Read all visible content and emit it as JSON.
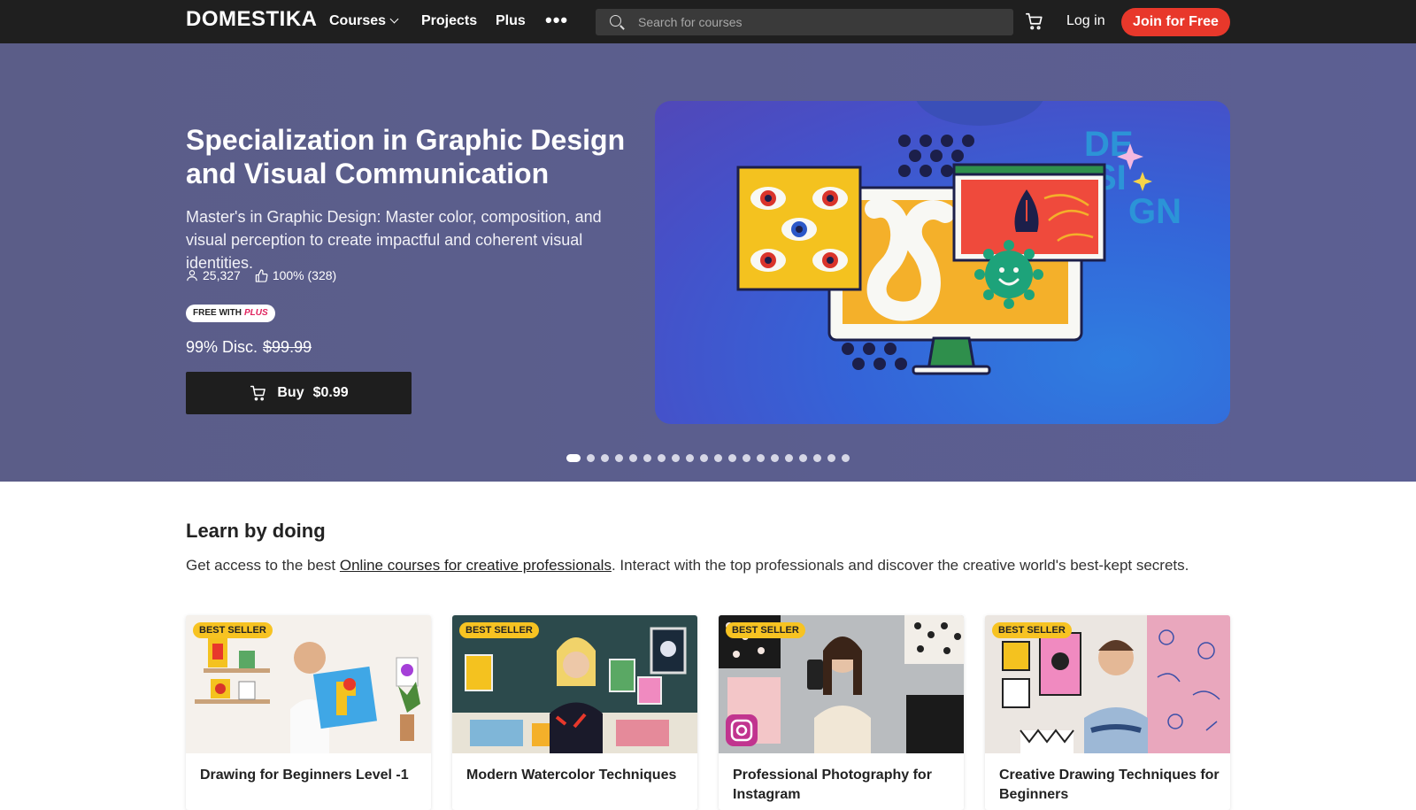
{
  "nav": {
    "logo": "DOMESTIKA",
    "courses": "Courses",
    "projects": "Projects",
    "plus": "Plus",
    "more": "•••",
    "search_placeholder": "Search for courses",
    "login": "Log in",
    "join": "Join for Free"
  },
  "hero": {
    "title": "Specialization in Graphic Design and Visual Communication",
    "subtitle": "Master's in Graphic Design: Master color, composition, and visual perception to create impactful and coherent visual identities.",
    "students": "25,327",
    "rating": "100% (328)",
    "badge_free": "FREE WITH",
    "badge_plus": "PLUS",
    "discount": "99% Disc.",
    "old_price": "$99.99",
    "buy_label": "Buy",
    "buy_price": "$0.99",
    "slide_count": 20,
    "active_slide": 0
  },
  "learn": {
    "title": "Learn by doing",
    "desc_pre": "Get access to the best ",
    "desc_link": "Online courses for creative professionals",
    "desc_post": ". Interact with the top professionals and discover the creative world's best-kept secrets."
  },
  "cards": [
    {
      "badge": "BEST SELLER",
      "title": "Drawing for Beginners Level -1",
      "author": ""
    },
    {
      "badge": "BEST SELLER",
      "title": "Modern Watercolor Techniques",
      "author": ""
    },
    {
      "badge": "BEST SELLER",
      "title": "Professional Photography for Instagram",
      "author": ""
    },
    {
      "badge": "BEST SELLER",
      "title": "Creative Drawing Techniques for Beginners",
      "author": ""
    }
  ],
  "colors": {
    "nav_bg": "#1f1f1f",
    "hero_bg": "#5b5e8e",
    "join_button": "#e8382b",
    "badge": "#f7c322",
    "plus_accent": "#e0245e"
  }
}
